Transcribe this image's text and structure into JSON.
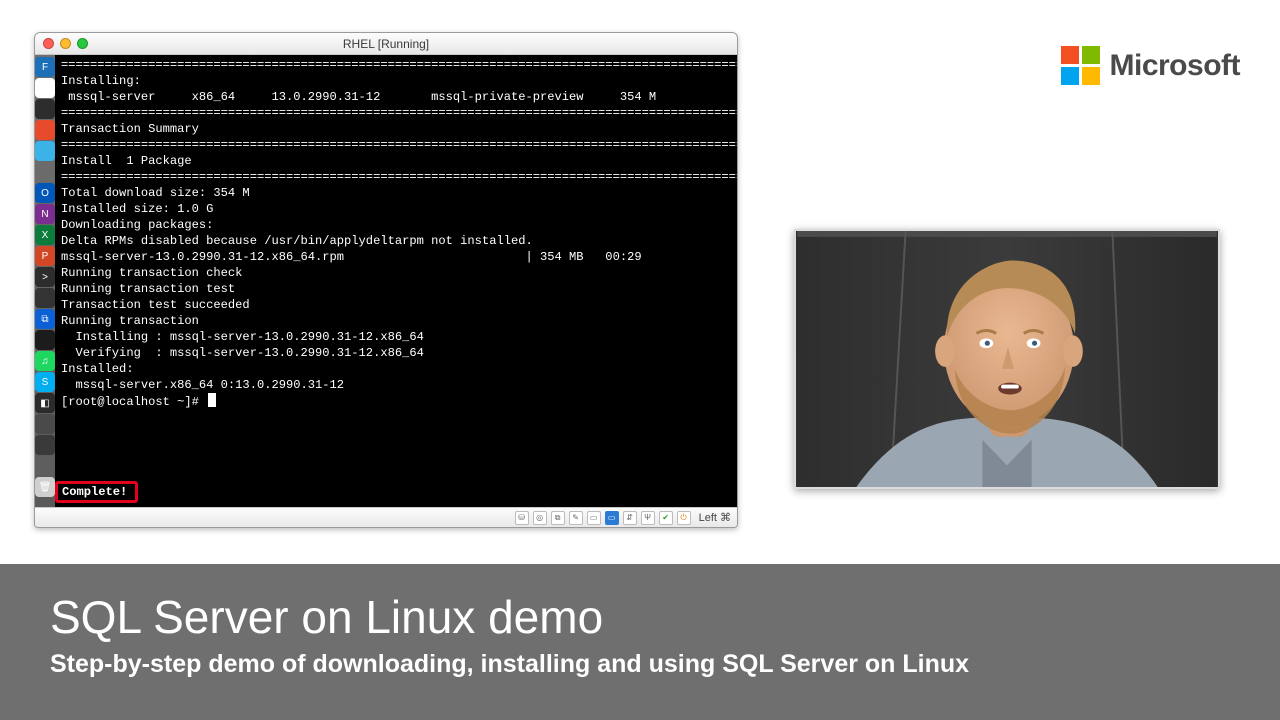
{
  "brand": {
    "name": "Microsoft",
    "tile_colors": [
      "#f25022",
      "#7fba00",
      "#00a4ef",
      "#ffb900"
    ]
  },
  "window": {
    "title": "RHEL [Running]",
    "status_label": "Left ⌘"
  },
  "dock": [
    {
      "bg": "#1d6fb8",
      "g": "F"
    },
    {
      "bg": "#ffffff",
      "g": ""
    },
    {
      "bg": "#2d2d2d",
      "g": ""
    },
    {
      "bg": "#e84b2c",
      "g": ""
    },
    {
      "bg": "#3cb3e7",
      "g": ""
    },
    {
      "bg": "#6b6b6b",
      "g": ""
    },
    {
      "bg": "#0057b8",
      "g": "O"
    },
    {
      "bg": "#7b2e8f",
      "g": "N"
    },
    {
      "bg": "#0b7c3b",
      "g": "X"
    },
    {
      "bg": "#d24726",
      "g": "P"
    },
    {
      "bg": "#2d2d2d",
      "g": ">"
    },
    {
      "bg": "#333333",
      "g": ""
    },
    {
      "bg": "#0b60d6",
      "g": "⧉"
    },
    {
      "bg": "#1c1c1c",
      "g": ""
    },
    {
      "bg": "#1ed760",
      "g": "♫"
    },
    {
      "bg": "#00aff0",
      "g": "S"
    },
    {
      "bg": "#2b2b2b",
      "g": "◧"
    },
    {
      "bg": "#4a4a4a",
      "g": ""
    },
    {
      "bg": "#3a3a3a",
      "g": ""
    },
    {
      "bg": "#5e5e5e",
      "g": ""
    },
    {
      "bg": "#cfcfcf",
      "g": "🗑"
    }
  ],
  "terminal": {
    "lines": [
      "Installing:",
      " mssql-server     x86_64     13.0.2990.31-12       mssql-private-preview     354 M",
      "",
      "Transaction Summary",
      "",
      "Install  1 Package",
      "",
      "Total download size: 354 M",
      "Installed size: 1.0 G",
      "Downloading packages:",
      "Delta RPMs disabled because /usr/bin/applydeltarpm not installed.",
      "mssql-server-13.0.2990.31-12.x86_64.rpm                         | 354 MB   00:29",
      "Running transaction check",
      "Running transaction test",
      "Transaction test succeeded",
      "Running transaction",
      "  Installing : mssql-server-13.0.2990.31-12.x86_64",
      "  Verifying  : mssql-server-13.0.2990.31-12.x86_64",
      "",
      "Installed:",
      "  mssql-server.x86_64 0:13.0.2990.31-12",
      "",
      ""
    ],
    "divider": "================================================================================================",
    "complete": "Complete!",
    "prompt": "[root@localhost ~]# "
  },
  "banner": {
    "title": "SQL Server on Linux demo",
    "subtitle": "Step-by-step demo of downloading, installing and using SQL Server on Linux"
  }
}
